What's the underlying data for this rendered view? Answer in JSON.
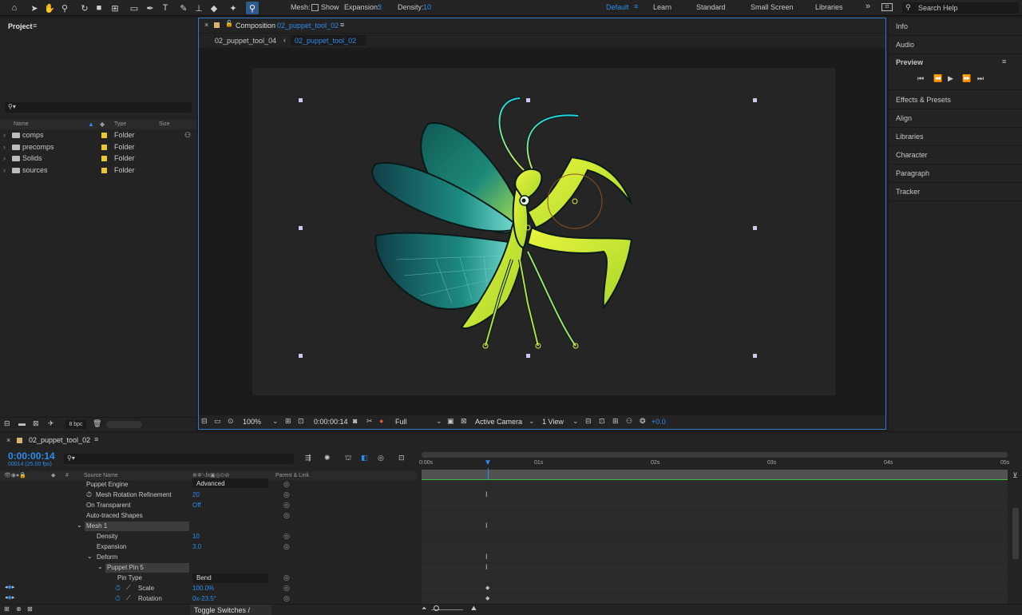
{
  "toolbar": {
    "mesh_label": "Mesh:",
    "show_label": "Show",
    "expansion_label": "Expansion:",
    "expansion_value": "3",
    "density_label": "Density:",
    "density_value": "10",
    "workspaces": [
      "Default",
      "Learn",
      "Standard",
      "Small Screen",
      "Libraries"
    ],
    "active_workspace": "Default",
    "search_placeholder": "Search Help"
  },
  "project": {
    "title": "Project",
    "columns": [
      "Name",
      "Type",
      "Size"
    ],
    "items": [
      {
        "name": "comps",
        "type": "Folder"
      },
      {
        "name": "precomps",
        "type": "Folder"
      },
      {
        "name": "Solids",
        "type": "Folder"
      },
      {
        "name": "sources",
        "type": "Folder"
      }
    ],
    "bpc": "8 bpc"
  },
  "composition": {
    "panel_prefix": "Composition",
    "panel_name": "02_puppet_tool_02",
    "tabs": [
      "02_puppet_tool_04",
      "02_puppet_tool_02"
    ],
    "zoom": "100%",
    "timecode": "0:00:00:14",
    "resolution": "Full",
    "camera": "Active Camera",
    "views": "1 View",
    "exposure": "+0.0"
  },
  "right_panel": {
    "items": [
      "Info",
      "Audio",
      "Preview",
      "Effects & Presets",
      "Align",
      "Libraries",
      "Character",
      "Paragraph",
      "Tracker"
    ]
  },
  "timeline": {
    "comp_name": "02_puppet_tool_02",
    "timecode": "0:00:00:14",
    "frame_info": "00014 (25.00 fps)",
    "columns": {
      "hash": "#",
      "source": "Source Name",
      "parent": "Parent & Link"
    },
    "ruler": [
      "0:00s",
      "01s",
      "02s",
      "03s",
      "04s",
      "05s"
    ],
    "toggle_label": "Toggle Switches / Modes",
    "rows": [
      {
        "name": "Puppet Engine",
        "value": "Advanced",
        "indent": 108
      },
      {
        "name": "Mesh Rotation Refinement",
        "value": "20",
        "indent": 120
      },
      {
        "name": "On Transparent",
        "value": "Off",
        "indent": 108
      },
      {
        "name": "Auto-traced Shapes",
        "value": "",
        "indent": 108
      },
      {
        "name": "Mesh 1",
        "value": "",
        "indent": 108
      },
      {
        "name": "Density",
        "value": "10",
        "indent": 121
      },
      {
        "name": "Expansion",
        "value": "3.0",
        "indent": 121
      },
      {
        "name": "Deform",
        "value": "",
        "indent": 121
      },
      {
        "name": "Puppet Pin 5",
        "value": "",
        "indent": 134
      },
      {
        "name": "Pin Type",
        "value": "Bend",
        "indent": 147
      },
      {
        "name": "Scale",
        "value": "100.0%",
        "indent": 173
      },
      {
        "name": "Rotation",
        "value": "0x-23.5°",
        "indent": 173
      }
    ]
  },
  "colors": {
    "accent": "#2d8ceb",
    "panel_bg": "#232323",
    "label_yellow": "#e6c635"
  }
}
